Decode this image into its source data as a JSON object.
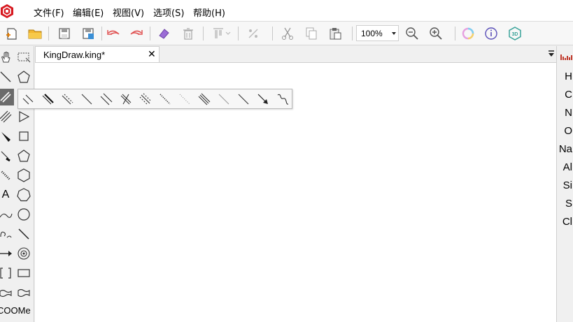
{
  "app": {
    "logo_icon": "kingdraw-logo-icon",
    "accent": "#d71920"
  },
  "menu": {
    "items": [
      {
        "label": "文件(F)"
      },
      {
        "label": "编辑(E)"
      },
      {
        "label": "视图(V)"
      },
      {
        "label": "选项(S)"
      },
      {
        "label": "帮助(H)"
      }
    ]
  },
  "toolbar": {
    "zoom_value": "100%",
    "buttons": [
      "new-file-icon",
      "open-folder-icon",
      "save-icon",
      "save-as-icon",
      "undo-icon",
      "redo-icon",
      "eraser-icon",
      "delete-icon",
      "align-icon",
      "flip-icon",
      "cut-icon",
      "copy-icon",
      "paste-icon",
      "zoom-out-icon",
      "zoom-in-icon",
      "color-wheel-icon",
      "info-icon",
      "3d-view-icon"
    ]
  },
  "document": {
    "tab_title": "KingDraw.king*",
    "close_glyph": "✕"
  },
  "left_tools": {
    "text_tool": "A",
    "abbreviation_tool": "COOMe"
  },
  "elements": [
    "H",
    "C",
    "N",
    "O",
    "Na",
    "Al",
    "Si",
    "S",
    "Cl"
  ]
}
